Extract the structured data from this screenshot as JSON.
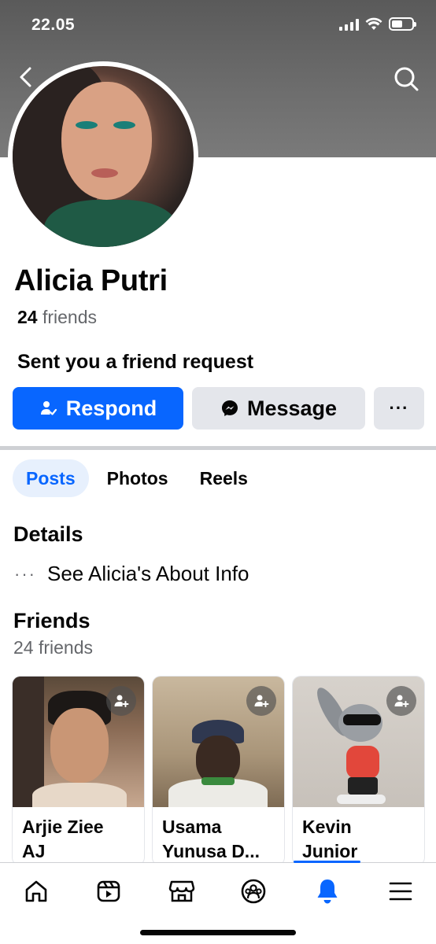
{
  "status_bar": {
    "time": "22.05"
  },
  "profile": {
    "name": "Alicia Putri",
    "friends_count": "24",
    "friends_label": "friends",
    "request_text": "Sent you a friend request"
  },
  "actions": {
    "respond_label": "Respond",
    "message_label": "Message",
    "more_label": "···"
  },
  "tabs": [
    {
      "label": "Posts",
      "active": true
    },
    {
      "label": "Photos",
      "active": false
    },
    {
      "label": "Reels",
      "active": false
    }
  ],
  "details": {
    "heading": "Details",
    "about_link": "See Alicia's About Info"
  },
  "friends": {
    "heading": "Friends",
    "subtitle": "24 friends",
    "cards": [
      {
        "name_line1": "Arjie Ziee",
        "name_line2": "AJ"
      },
      {
        "name_line1": "Usama",
        "name_line2": "Yunusa D..."
      },
      {
        "name_line1": "Kevin",
        "name_line2": "Junior"
      }
    ]
  },
  "bottom_nav": [
    "home-icon",
    "video-icon",
    "marketplace-icon",
    "groups-icon",
    "notifications-icon",
    "menu-icon"
  ],
  "colors": {
    "accent": "#0866ff",
    "secondary_button": "#e4e6eb",
    "muted_text": "#65676b"
  }
}
